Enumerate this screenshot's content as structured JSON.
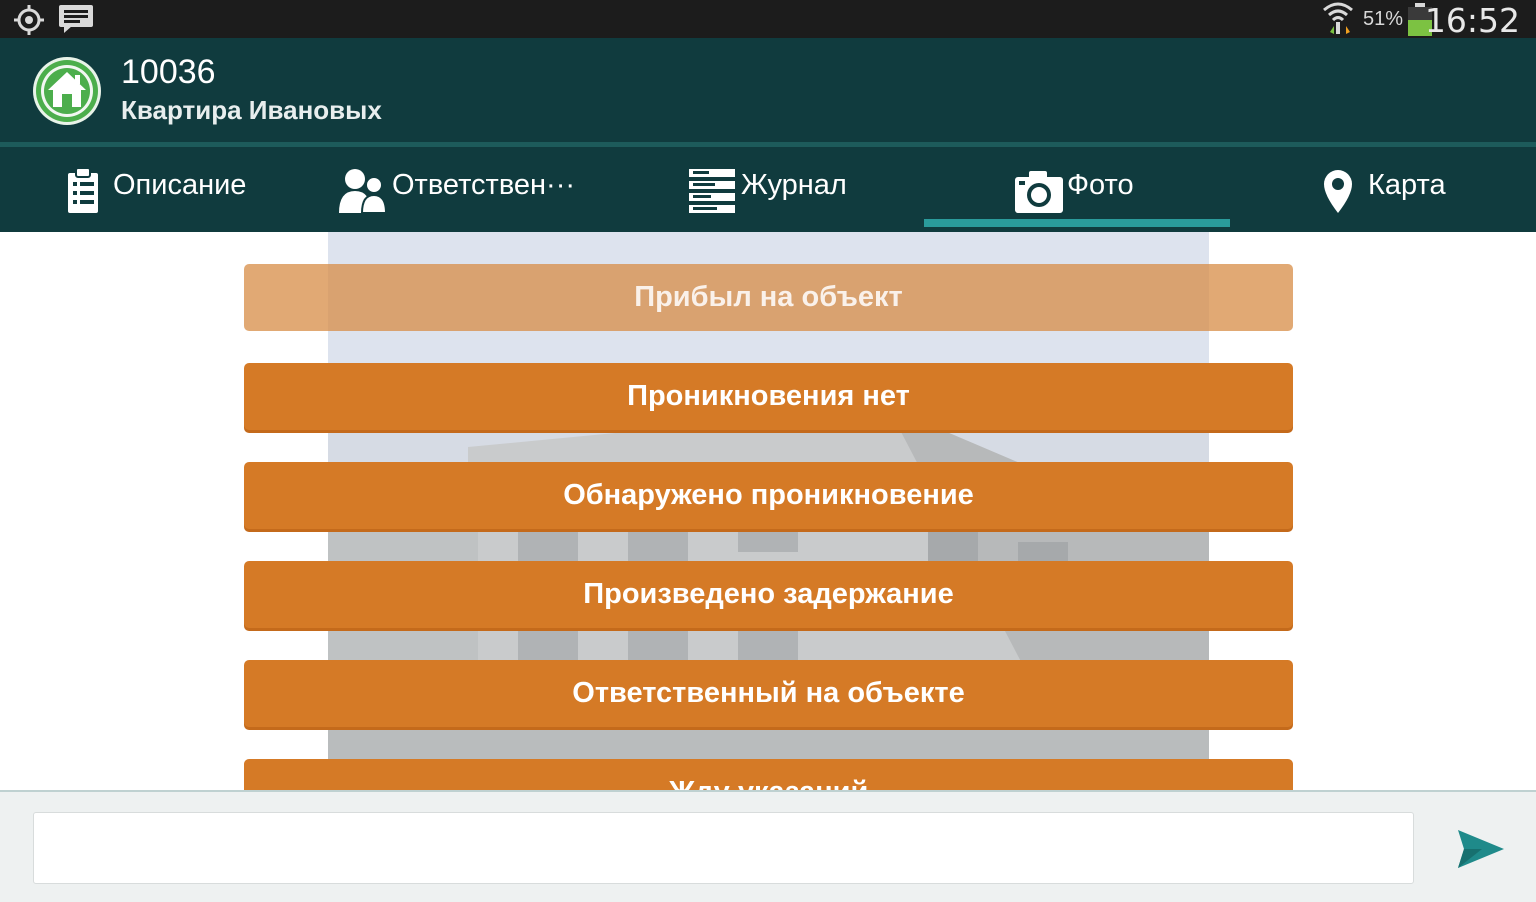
{
  "status_bar": {
    "battery_percent": "51%",
    "time": "16:52",
    "icons": [
      "gps-icon",
      "message-icon",
      "wifi-icon",
      "battery-icon"
    ]
  },
  "header": {
    "object_id": "10036",
    "object_name": "Квартира Ивановых",
    "logo_icon": "home-icon"
  },
  "tabs": [
    {
      "label": "Описание",
      "icon": "clipboard-icon",
      "selected": false
    },
    {
      "label": "Ответствен···",
      "icon": "people-icon",
      "selected": false
    },
    {
      "label": "Журнал",
      "icon": "journal-icon",
      "selected": false
    },
    {
      "label": "Фото",
      "icon": "camera-icon",
      "selected": true
    },
    {
      "label": "Карта",
      "icon": "map-pin-icon",
      "selected": false
    }
  ],
  "actions": [
    {
      "label": "Прибыл на объект",
      "state": "pressed"
    },
    {
      "label": "Проникновения нет",
      "state": "normal"
    },
    {
      "label": "Обнаружено проникновение",
      "state": "normal"
    },
    {
      "label": "Произведено задержание",
      "state": "normal"
    },
    {
      "label": "Ответственный на объекте",
      "state": "normal"
    },
    {
      "label": "Жду указаний",
      "state": "normal"
    }
  ],
  "message_input": {
    "value": "",
    "placeholder": ""
  },
  "send_icon": "send-icon",
  "colors": {
    "header_bg": "#103b3e",
    "accent": "#2a9b9b",
    "action_orange": "#d57a26",
    "logo_green": "#4cae4c"
  }
}
